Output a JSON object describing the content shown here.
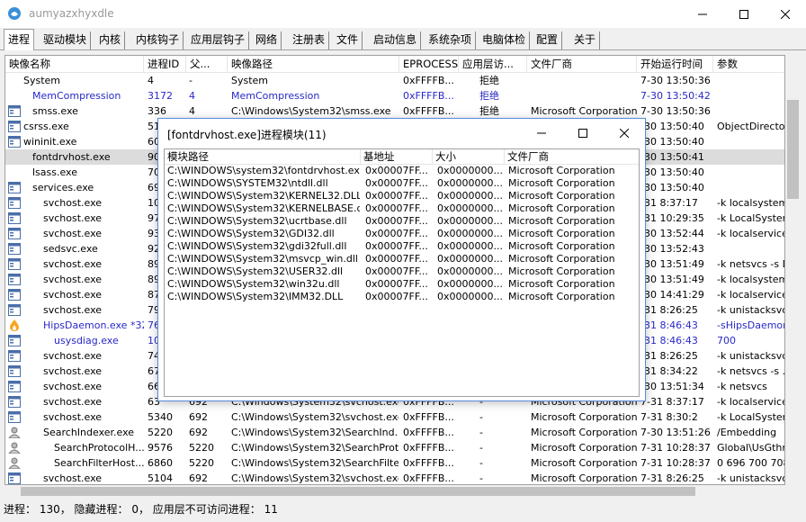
{
  "window": {
    "title": "aumyazxhyxdle"
  },
  "tabs": [
    "进程",
    "驱动模块",
    "内核",
    "内核钩子",
    "应用层钩子",
    "网络",
    "注册表",
    "文件",
    "启动信息",
    "系统杂项",
    "电脑体检",
    "配置",
    "关于"
  ],
  "process_table": {
    "columns": [
      "映像名称",
      "进程ID",
      "父...",
      "映像路径",
      "EPROCESS",
      "应用层访...",
      "文件厂商",
      "开始运行时间",
      "参数"
    ],
    "rows": [
      {
        "icon": "none",
        "name": "System",
        "pid": "4",
        "ppid": "-",
        "path": "System",
        "eprocess": "0xFFFFB...",
        "access": "拒绝",
        "vendor": "",
        "start": "7-30 13:50:36",
        "args": "",
        "color": "black"
      },
      {
        "icon": "none",
        "name": "MemCompression",
        "pid": "3172",
        "ppid": "4",
        "path": "MemCompression",
        "eprocess": "0xFFFFB...",
        "access": "拒绝",
        "vendor": "",
        "start": "7-30 13:50:42",
        "args": "",
        "color": "blue"
      },
      {
        "icon": "window",
        "name": "smss.exe",
        "pid": "336",
        "ppid": "4",
        "path": "C:\\Windows\\System32\\smss.exe",
        "eprocess": "0xFFFFB...",
        "access": "拒绝",
        "vendor": "Microsoft Corporation",
        "start": "7-30 13:50:36",
        "args": "",
        "color": "black"
      },
      {
        "icon": "window",
        "name": "csrss.exe",
        "pid": "51",
        "ppid": "",
        "path": "",
        "eprocess": "",
        "access": "",
        "vendor": "",
        "start": "-30 13:50:40",
        "args": "ObjectDirector...",
        "color": "black"
      },
      {
        "icon": "window",
        "name": "wininit.exe",
        "pid": "60",
        "ppid": "",
        "path": "",
        "eprocess": "",
        "access": "",
        "vendor": "",
        "start": "-30 13:50:40",
        "args": "",
        "color": "black"
      },
      {
        "icon": "none",
        "name": "fontdrvhost.exe",
        "pid": "90",
        "ppid": "",
        "path": "",
        "eprocess": "",
        "access": "",
        "vendor": "",
        "start": "-30 13:50:41",
        "args": "",
        "color": "black",
        "selected": true
      },
      {
        "icon": "none",
        "name": "lsass.exe",
        "pid": "70",
        "ppid": "",
        "path": "",
        "eprocess": "",
        "access": "",
        "vendor": "",
        "start": "-30 13:50:40",
        "args": "",
        "color": "black"
      },
      {
        "icon": "window",
        "name": "services.exe",
        "pid": "69",
        "ppid": "",
        "path": "",
        "eprocess": "",
        "access": "",
        "vendor": "",
        "start": "-30 13:50:40",
        "args": "",
        "color": "black"
      },
      {
        "icon": "window",
        "name": "svchost.exe",
        "pid": "10",
        "ppid": "",
        "path": "",
        "eprocess": "",
        "access": "",
        "vendor": "",
        "start": "-31 8:37:17",
        "args": "-k localsystem...",
        "color": "black"
      },
      {
        "icon": "window",
        "name": "svchost.exe",
        "pid": "97",
        "ppid": "",
        "path": "",
        "eprocess": "",
        "access": "",
        "vendor": "",
        "start": "-31 10:29:35",
        "args": "-k LocalSystem...",
        "color": "black"
      },
      {
        "icon": "window",
        "name": "svchost.exe",
        "pid": "93",
        "ppid": "",
        "path": "",
        "eprocess": "",
        "access": "",
        "vendor": "",
        "start": "-30 13:52:44",
        "args": "-k localservice...",
        "color": "black"
      },
      {
        "icon": "window",
        "name": "sedsvc.exe",
        "pid": "92",
        "ppid": "",
        "path": "",
        "eprocess": "",
        "access": "",
        "vendor": "",
        "start": "-30 13:52:43",
        "args": "",
        "color": "black"
      },
      {
        "icon": "window",
        "name": "svchost.exe",
        "pid": "89",
        "ppid": "",
        "path": "",
        "eprocess": "",
        "access": "",
        "vendor": "",
        "start": "-30 13:51:49",
        "args": "-k netsvcs -s D...",
        "color": "black"
      },
      {
        "icon": "window",
        "name": "svchost.exe",
        "pid": "89",
        "ppid": "",
        "path": "",
        "eprocess": "",
        "access": "",
        "vendor": "",
        "start": "-30 13:51:49",
        "args": "-k localsystem...",
        "color": "black"
      },
      {
        "icon": "window",
        "name": "svchost.exe",
        "pid": "87",
        "ppid": "",
        "path": "",
        "eprocess": "",
        "access": "",
        "vendor": "",
        "start": "-30 14:41:29",
        "args": "-k localservice ...",
        "color": "black"
      },
      {
        "icon": "window",
        "name": "svchost.exe",
        "pid": "79",
        "ppid": "",
        "path": "",
        "eprocess": "",
        "access": "",
        "vendor": "",
        "start": "-31 8:26:25",
        "args": "-k unistacksvc...",
        "color": "black"
      },
      {
        "icon": "flame",
        "name": "HipsDaemon.exe *32",
        "pid": "76",
        "ppid": "",
        "path": "",
        "eprocess": "",
        "access": "",
        "vendor": "",
        "start": "-31 8:46:43",
        "args": "-sHipsDaemon",
        "color": "blue"
      },
      {
        "icon": "window",
        "name": "usysdiag.exe",
        "pid": "10",
        "ppid": "",
        "path": "",
        "eprocess": "",
        "access": "",
        "vendor": "",
        "start": "-31 8:46:43",
        "args": "700",
        "color": "blue"
      },
      {
        "icon": "window",
        "name": "svchost.exe",
        "pid": "74",
        "ppid": "",
        "path": "",
        "eprocess": "",
        "access": "",
        "vendor": "",
        "start": "-31 8:26:25",
        "args": "-k unistacksvc...",
        "color": "black"
      },
      {
        "icon": "window",
        "name": "svchost.exe",
        "pid": "67",
        "ppid": "",
        "path": "",
        "eprocess": "",
        "access": "",
        "vendor": "",
        "start": "-31 8:34:22",
        "args": "-k netsvcs -s ...",
        "color": "black"
      },
      {
        "icon": "window",
        "name": "svchost.exe",
        "pid": "66",
        "ppid": "",
        "path": "",
        "eprocess": "",
        "access": "",
        "vendor": "",
        "start": "-30 13:51:34",
        "args": "-k netsvcs",
        "color": "black"
      },
      {
        "icon": "window",
        "name": "svchost.exe",
        "pid": "63",
        "ppid": "692",
        "path": "C:\\Windows\\System32\\svchost.exe",
        "eprocess": "0xFFFFB...",
        "access": "-",
        "vendor": "Microsoft Corporation",
        "start": "7-31 8:37:17",
        "args": "-k localservice...",
        "color": "black"
      },
      {
        "icon": "window",
        "name": "svchost.exe",
        "pid": "5340",
        "ppid": "692",
        "path": "C:\\Windows\\System32\\svchost.exe",
        "eprocess": "0xFFFFB...",
        "access": "-",
        "vendor": "Microsoft Corporation",
        "start": "7-31 8:30:2",
        "args": "-k LocalSystem...",
        "color": "black"
      },
      {
        "icon": "user",
        "name": "SearchIndexer.exe",
        "pid": "5220",
        "ppid": "692",
        "path": "C:\\Windows\\System32\\SearchInd...",
        "eprocess": "0xFFFFB...",
        "access": "-",
        "vendor": "Microsoft Corporation",
        "start": "7-30 13:51:26",
        "args": "/Embedding",
        "color": "black"
      },
      {
        "icon": "user",
        "name": "SearchProtocolH...",
        "pid": "9576",
        "ppid": "5220",
        "path": "C:\\Windows\\System32\\SearchProt...",
        "eprocess": "0xFFFFB...",
        "access": "-",
        "vendor": "Microsoft Corporation",
        "start": "7-31 10:28:37",
        "args": "Global\\UsGthr...",
        "color": "black"
      },
      {
        "icon": "user",
        "name": "SearchFilterHost...",
        "pid": "6860",
        "ppid": "5220",
        "path": "C:\\Windows\\System32\\SearchFilte...",
        "eprocess": "0xFFFFB...",
        "access": "-",
        "vendor": "Microsoft Corporation",
        "start": "7-31 10:28:37",
        "args": "0 696 700 708...",
        "color": "black"
      },
      {
        "icon": "window",
        "name": "svchost.exe",
        "pid": "5104",
        "ppid": "692",
        "path": "C:\\Windows\\System32\\svchost.exe",
        "eprocess": "0xFFFFB...",
        "access": "-",
        "vendor": "Microsoft Corporation",
        "start": "7-31 8:26:25",
        "args": "-k unistacksvc...",
        "color": "black"
      }
    ]
  },
  "status_bar": {
    "text": "进程：  130，  隐藏进程：  0，  应用层不可访问进程：  11"
  },
  "module_dialog": {
    "title": "[fontdrvhost.exe]进程模块(11)",
    "columns": [
      "模块路径",
      "基地址",
      "大小",
      "文件厂商"
    ],
    "rows": [
      {
        "path": "C:\\WINDOWS\\system32\\fontdrvhost.exe",
        "base": "0x00007FF...",
        "size": "0x0000000...",
        "vendor": "Microsoft Corporation"
      },
      {
        "path": "C:\\WINDOWS\\SYSTEM32\\ntdll.dll",
        "base": "0x00007FF...",
        "size": "0x0000000...",
        "vendor": "Microsoft Corporation"
      },
      {
        "path": "C:\\WINDOWS\\System32\\KERNEL32.DLL",
        "base": "0x00007FF...",
        "size": "0x0000000...",
        "vendor": "Microsoft Corporation"
      },
      {
        "path": "C:\\WINDOWS\\System32\\KERNELBASE.dll",
        "base": "0x00007FF...",
        "size": "0x0000000...",
        "vendor": "Microsoft Corporation"
      },
      {
        "path": "C:\\WINDOWS\\System32\\ucrtbase.dll",
        "base": "0x00007FF...",
        "size": "0x0000000...",
        "vendor": "Microsoft Corporation"
      },
      {
        "path": "C:\\WINDOWS\\System32\\GDI32.dll",
        "base": "0x00007FF...",
        "size": "0x0000000...",
        "vendor": "Microsoft Corporation"
      },
      {
        "path": "C:\\WINDOWS\\System32\\gdi32full.dll",
        "base": "0x00007FF...",
        "size": "0x0000000...",
        "vendor": "Microsoft Corporation"
      },
      {
        "path": "C:\\WINDOWS\\System32\\msvcp_win.dll",
        "base": "0x00007FF...",
        "size": "0x0000000...",
        "vendor": "Microsoft Corporation"
      },
      {
        "path": "C:\\WINDOWS\\System32\\USER32.dll",
        "base": "0x00007FF...",
        "size": "0x0000000...",
        "vendor": "Microsoft Corporation"
      },
      {
        "path": "C:\\WINDOWS\\System32\\win32u.dll",
        "base": "0x00007FF...",
        "size": "0x0000000...",
        "vendor": "Microsoft Corporation"
      },
      {
        "path": "C:\\WINDOWS\\System32\\IMM32.DLL",
        "base": "0x00007FF...",
        "size": "0x0000000...",
        "vendor": "Microsoft Corporation"
      }
    ]
  }
}
